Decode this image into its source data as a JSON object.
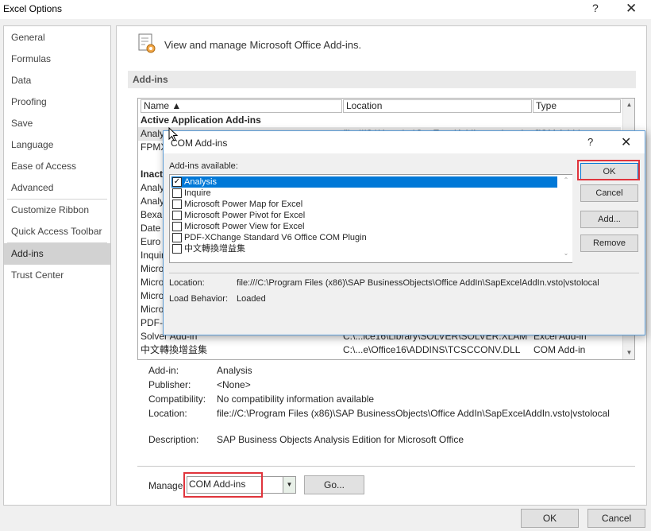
{
  "window": {
    "title": "Excel Options",
    "help": "?",
    "close": "✕"
  },
  "sidebar": {
    "items": [
      {
        "label": "General"
      },
      {
        "label": "Formulas"
      },
      {
        "label": "Data"
      },
      {
        "label": "Proofing"
      },
      {
        "label": "Save"
      },
      {
        "label": "Language"
      },
      {
        "label": "Ease of Access"
      },
      {
        "label": "Advanced"
      },
      {
        "label": "Customize Ribbon"
      },
      {
        "label": "Quick Access Toolbar"
      },
      {
        "label": "Add-ins"
      },
      {
        "label": "Trust Center"
      }
    ],
    "active": "Add-ins"
  },
  "main": {
    "header": "View and manage Microsoft Office Add-ins.",
    "section": "Add-ins",
    "columns": {
      "name": "Name ▲",
      "location": "Location",
      "type": "Type"
    },
    "rows": [
      {
        "name": "Active Application Add-ins",
        "location": "",
        "type": ""
      },
      {
        "name": "Analy",
        "location": "file:///C:\\Users\\...\\SapExcelAddIn.vsto|vstolocal",
        "type": "COM Add-in"
      },
      {
        "name": "FPMX",
        "location": "",
        "type": ""
      },
      {
        "name": "",
        "location": "",
        "type": ""
      },
      {
        "name": "Inact",
        "location": "",
        "type": ""
      },
      {
        "name": "Analy",
        "location": "",
        "type": ""
      },
      {
        "name": "Analy",
        "location": "",
        "type": ""
      },
      {
        "name": "Bexar",
        "location": "",
        "type": ""
      },
      {
        "name": "Date (",
        "location": "",
        "type": ""
      },
      {
        "name": "Euro C",
        "location": "",
        "type": ""
      },
      {
        "name": "Inquir",
        "location": "",
        "type": ""
      },
      {
        "name": "Micro",
        "location": "",
        "type": ""
      },
      {
        "name": "Micro",
        "location": "",
        "type": ""
      },
      {
        "name": "Micro",
        "location": "",
        "type": ""
      },
      {
        "name": "Micro",
        "location": "",
        "type": ""
      },
      {
        "name": "PDF-X",
        "location": "",
        "type": ""
      },
      {
        "name": "Solver Add-in",
        "location": "C:\\...ice16\\Library\\SOLVER\\SOLVER.XLAM",
        "type": "Excel Add-in"
      },
      {
        "name": "中文轉換增益集",
        "location": "C:\\...e\\Office16\\ADDINS\\TCSCCONV.DLL",
        "type": "COM Add-in"
      }
    ],
    "details": {
      "addin_label": "Add-in:",
      "addin_value": "Analysis",
      "publisher_label": "Publisher:",
      "publisher_value": "<None>",
      "compat_label": "Compatibility:",
      "compat_value": "No compatibility information available",
      "location_label": "Location:",
      "location_value": "file://C:\\Program Files (x86)\\SAP BusinessObjects\\Office AddIn\\SapExcelAddIn.vsto|vstolocal",
      "desc_label": "Description:",
      "desc_value": "SAP Business Objects Analysis Edition for Microsoft Office"
    },
    "manage_label": "Manage:",
    "manage_value": "COM Add-ins",
    "go_label": "Go..."
  },
  "footer": {
    "ok": "OK",
    "cancel": "Cancel"
  },
  "dialog": {
    "title": "COM Add-ins",
    "help": "?",
    "close": "✕",
    "available_label": "Add-ins available:",
    "items": [
      {
        "label": "Analysis",
        "checked": true,
        "selected": true
      },
      {
        "label": "Inquire",
        "checked": false
      },
      {
        "label": "Microsoft Power Map for Excel",
        "checked": false
      },
      {
        "label": "Microsoft Power Pivot for Excel",
        "checked": false
      },
      {
        "label": "Microsoft Power View for Excel",
        "checked": false
      },
      {
        "label": "PDF-XChange Standard V6 Office COM Plugin",
        "checked": false
      },
      {
        "label": "中文轉換增益集",
        "checked": false
      }
    ],
    "ok": "OK",
    "cancel": "Cancel",
    "add": "Add...",
    "remove": "Remove",
    "location_label": "Location:",
    "location_value": "file:///C:\\Program Files (x86)\\SAP BusinessObjects\\Office AddIn\\SapExcelAddIn.vsto|vstolocal",
    "load_behavior_label": "Load Behavior:",
    "load_behavior_value": "Loaded"
  },
  "colors": {
    "highlight": "#e0343c",
    "selection": "#0078d7"
  }
}
